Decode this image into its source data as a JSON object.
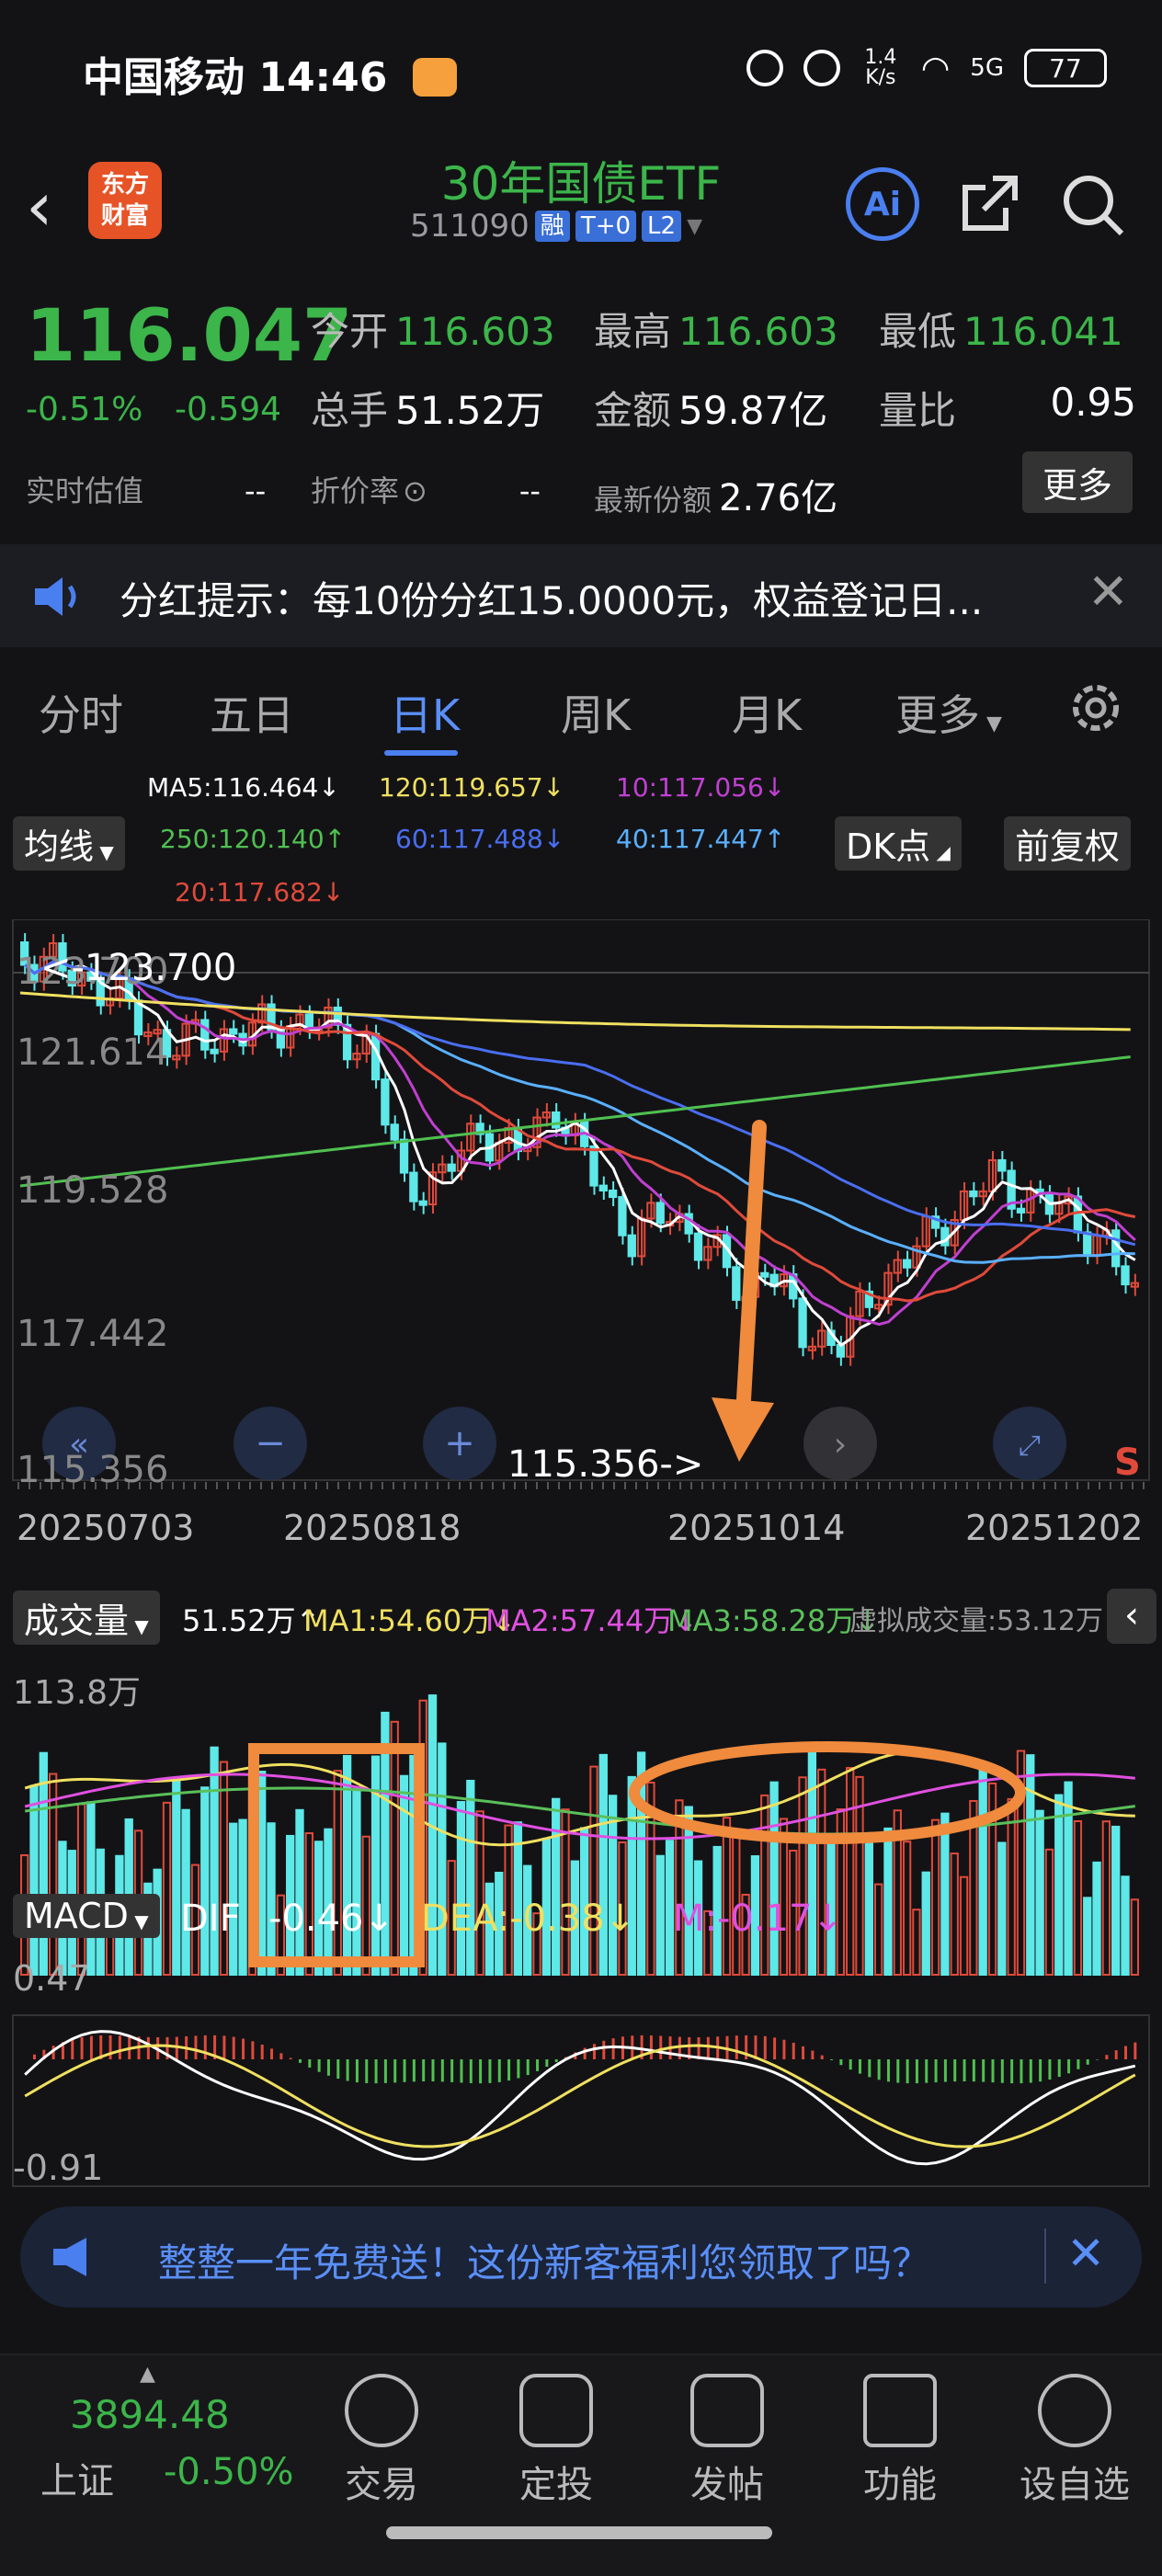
{
  "status": {
    "carrier": "中国移动",
    "time": "14:46",
    "net_speed": "1.4\nK/s",
    "signal": "5G",
    "battery": "77"
  },
  "header": {
    "title": "30年国债ETF",
    "code": "511090",
    "tags": [
      "融",
      "T+0",
      "L2"
    ],
    "logo": "东方\n财富",
    "ai": "Ai"
  },
  "quote": {
    "price": "116.047",
    "pct": "-0.51%",
    "chg": "-0.594",
    "open_label": "今开",
    "open": "116.603",
    "high_label": "最高",
    "high": "116.603",
    "low_label": "最低",
    "low": "116.041",
    "vol_label": "总手",
    "vol": "51.52万",
    "amt_label": "金额",
    "amt": "59.87亿",
    "ratio_label": "量比",
    "ratio": "0.95",
    "est_label": "实时估值",
    "est": "--",
    "disc_label": "折价率",
    "disc": "--",
    "share_label": "最新份额",
    "share": "2.76亿",
    "more": "更多"
  },
  "notice": {
    "text": "分红提示：每10份分红15.0000元，权益登记日..."
  },
  "tabs": [
    "分时",
    "五日",
    "日K",
    "周K",
    "月K",
    "更多"
  ],
  "active_tab": "日K",
  "ma": {
    "ma_button": "均线",
    "dk_button": "DK点",
    "fq_button": "前复权",
    "ma5": "MA5:116.464↓",
    "ma120": "120:119.657↓",
    "ma10": "10:117.056↓",
    "ma250": "250:120.140↑",
    "ma60": "60:117.488↓",
    "ma40": "40:117.447↑",
    "ma20": "20:117.682↓"
  },
  "kline": {
    "y_labels": [
      "123.700",
      "121.614",
      "119.528",
      "117.442",
      "115.356"
    ],
    "max_label": "<-123.700",
    "min_label": "115.356->",
    "dates": [
      "20250703",
      "20250818",
      "20251014",
      "20251202"
    ],
    "s_mark": "S"
  },
  "volume": {
    "label": "成交量",
    "cur": "51.52万↑",
    "ma1": "MA1:54.60万↓",
    "ma2": "MA2:57.44万↓",
    "ma3": "MA3:58.28万↓",
    "virtual": "虚拟成交量:53.12万",
    "max": "113.8万"
  },
  "macd": {
    "label": "MACD",
    "dif_label": "DIF",
    "dif": "-0.46↓",
    "dea": "DEA:-0.38↓",
    "m": "M:-0.17↓",
    "max": "0.47",
    "min": "-0.91"
  },
  "ad": {
    "text": "整整一年免费送！这份新客福利您领取了吗？"
  },
  "bottom": {
    "index_value": "3894.48",
    "index_name": "上证",
    "index_pct": "-0.50%",
    "items": [
      "交易",
      "定投",
      "发帖",
      "功能",
      "设自选"
    ]
  },
  "colors": {
    "up": "#e04a3a",
    "down": "#5ee8e8",
    "green": "#3cb54a",
    "accent": "#4a7ff0",
    "annotation": "#f08a3c"
  }
}
